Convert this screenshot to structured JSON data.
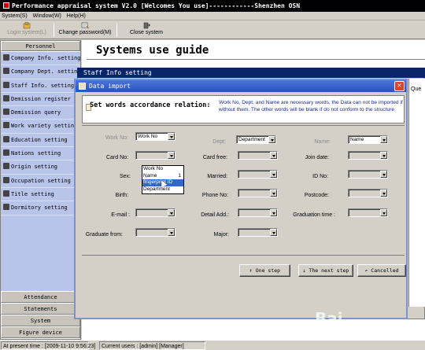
{
  "window": {
    "title": "Performance appraisal system V2.0 [Welcomes You use]------------Shenzhen OSN"
  },
  "menu": [
    "System(S)",
    "Window(W)",
    "Help(H)"
  ],
  "toolbar": {
    "login": "Login system(L)",
    "change_password": "Change password(M)",
    "close": "Close system"
  },
  "sidebar": {
    "header": "Personnel",
    "items": [
      "Company Info. setting",
      "Company Dept. setting",
      "Staff Info. setting",
      "Demission register",
      "Demission query",
      "Work variety setting",
      "Education setting",
      "Nations setting",
      "Origin setting",
      "Occupation setting",
      "Title setting",
      "Dormitory setting"
    ],
    "bottom": [
      "Attendance",
      "Statements",
      "System",
      "Figure device"
    ]
  },
  "content": {
    "guide_title": "Systems use guide",
    "bg_window_title": "Staff Info setting",
    "bg_right_text": "Que"
  },
  "dialog": {
    "title": "Data import",
    "heading": "Set words accordance relation:",
    "note": "Work No, Dept. and Name are necessary words, the Data can not be imported if without them. The other words will be blank if do not conform to the structure",
    "fields": {
      "work_no": {
        "label": "Work No:",
        "value": "Work No"
      },
      "dept": {
        "label": "Dept:",
        "value": "Department"
      },
      "name": {
        "label": "Name:",
        "value": "Name"
      },
      "card_no": {
        "label": "Card No:"
      },
      "card_free": {
        "label": "Card free:"
      },
      "join_date": {
        "label": "Join date:"
      },
      "sex": {
        "label": "Sex:"
      },
      "married": {
        "label": "Married:"
      },
      "id_no": {
        "label": "ID No:"
      },
      "birth": {
        "label": "Birth:"
      },
      "phone_no": {
        "label": "Phone No:"
      },
      "postcode": {
        "label": "Postcode:"
      },
      "email": {
        "label": "E-mail :"
      },
      "detail_add": {
        "label": "Detail Add.:"
      },
      "graduation_time": {
        "label": "Graduation time :"
      },
      "graduate_from": {
        "label": "Graduate from:"
      },
      "major": {
        "label": "Major:"
      }
    },
    "dropdown_options": [
      {
        "label": "Work No",
        "num": ""
      },
      {
        "label": "Name",
        "num": "1"
      },
      {
        "label": "fingerprint ID",
        "num": "",
        "selected": true
      },
      {
        "label": "Department",
        "num": ""
      }
    ],
    "buttons": {
      "prev": "↑  One step",
      "next": "↓ The next step",
      "cancel": "↶  Cancelled"
    }
  },
  "status": {
    "present_time": "At present time : [2009-11-10 9:56:23]",
    "current_users": "Current users : [admin] [Manager]"
  },
  "watermark": "Bai"
}
